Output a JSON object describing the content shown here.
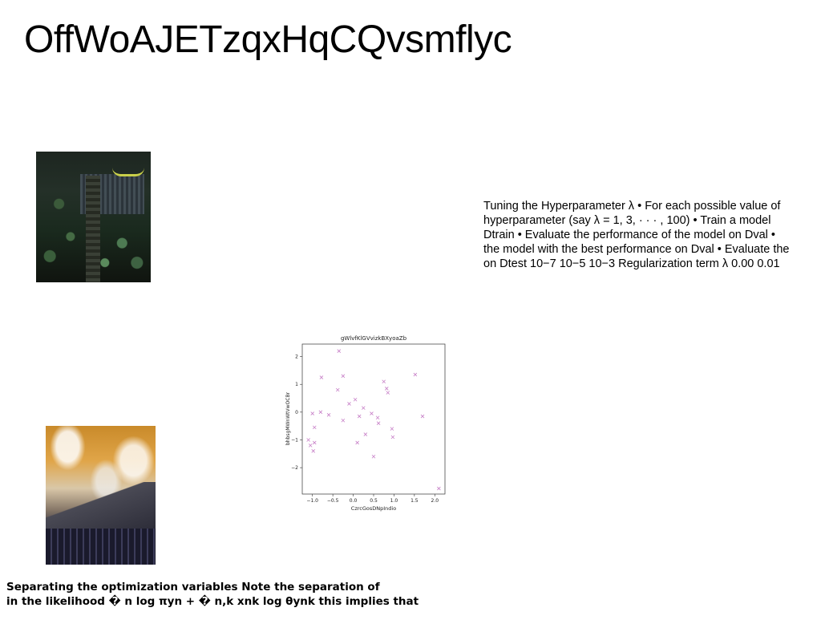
{
  "page": {
    "title": "OffWoAJETzqxHqCQvsmflyc"
  },
  "text_block": {
    "lines": [
      "Tuning the Hyperparameter λ • For each possible value of",
      "hyperparameter (say λ = 1, 3, · · · , 100) • Train a model",
      "Dtrain • Evaluate the performance of the model on Dval •",
      "the model with the best performance on Dval • Evaluate the",
      "on Dtest 10−7 10−5 10−3 Regularization term λ 0.00 0.01"
    ]
  },
  "caption": {
    "lines": [
      "Separating the optimization variables Note the separation of",
      "in the likelihood � n log πyn + � n,k xnk log θynk this implies that"
    ]
  },
  "chart_data": {
    "type": "scatter",
    "title": "gWlvfKlGVvizkBXyoaZb",
    "xlabel": "CzrcGosDNpIndio",
    "ylabel": "bhbsgMWnWtVwOCBr",
    "xlim": [
      -1.25,
      2.25
    ],
    "ylim": [
      -2.95,
      2.45
    ],
    "xticks": [
      -1.0,
      -0.5,
      0.0,
      0.5,
      1.0,
      1.5,
      2.0
    ],
    "xtick_labels": [
      "−1.0",
      "−0.5",
      "0.0",
      "0.5",
      "1.0",
      "1.5",
      "2.0"
    ],
    "yticks": [
      -2,
      -1,
      0,
      1,
      2
    ],
    "ytick_labels": [
      "−2",
      "−1",
      "0",
      "1",
      "2"
    ],
    "marker": "x",
    "color": "#c77fc7",
    "grid": false,
    "points": [
      {
        "x": -1.1,
        "y": -1.0
      },
      {
        "x": -1.05,
        "y": -1.2
      },
      {
        "x": -1.0,
        "y": -0.05
      },
      {
        "x": -0.98,
        "y": -1.4
      },
      {
        "x": -0.95,
        "y": -0.55
      },
      {
        "x": -0.95,
        "y": -1.1
      },
      {
        "x": -0.8,
        "y": 0.0
      },
      {
        "x": -0.78,
        "y": 1.25
      },
      {
        "x": -0.6,
        "y": -0.1
      },
      {
        "x": -0.35,
        "y": 2.2
      },
      {
        "x": -0.38,
        "y": 0.8
      },
      {
        "x": -0.25,
        "y": 1.3
      },
      {
        "x": -0.25,
        "y": -0.3
      },
      {
        "x": -0.1,
        "y": 0.3
      },
      {
        "x": 0.05,
        "y": 0.45
      },
      {
        "x": 0.1,
        "y": -1.1
      },
      {
        "x": 0.15,
        "y": -0.15
      },
      {
        "x": 0.25,
        "y": 0.15
      },
      {
        "x": 0.3,
        "y": -0.8
      },
      {
        "x": 0.45,
        "y": -0.05
      },
      {
        "x": 0.5,
        "y": -1.6
      },
      {
        "x": 0.6,
        "y": -0.2
      },
      {
        "x": 0.62,
        "y": -0.4
      },
      {
        "x": 0.75,
        "y": 1.1
      },
      {
        "x": 0.82,
        "y": 0.85
      },
      {
        "x": 0.85,
        "y": 0.7
      },
      {
        "x": 0.95,
        "y": -0.6
      },
      {
        "x": 0.97,
        "y": -0.9
      },
      {
        "x": 1.52,
        "y": 1.35
      },
      {
        "x": 1.7,
        "y": -0.15
      },
      {
        "x": 2.1,
        "y": -2.75
      }
    ]
  }
}
